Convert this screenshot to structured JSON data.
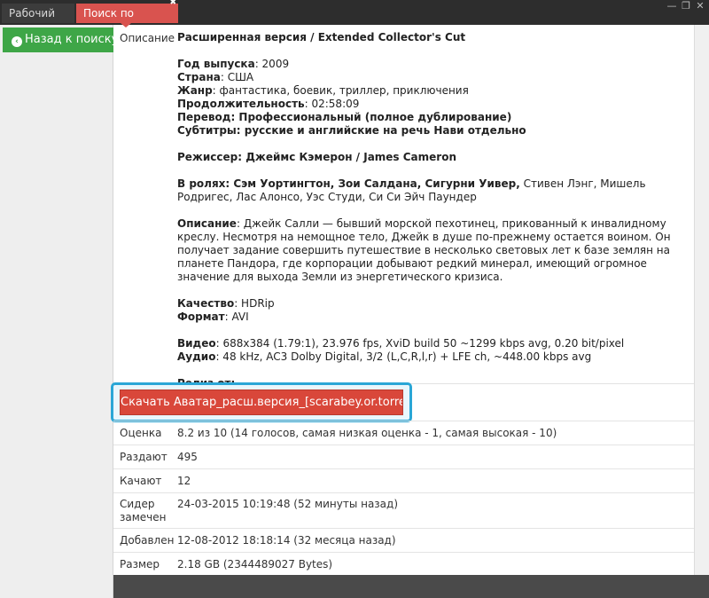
{
  "tabs": [
    {
      "label": "Рабочий стол"
    },
    {
      "label": "Поиск по торрентам"
    }
  ],
  "sidebar": {
    "back_label": "Назад к поиску"
  },
  "description": {
    "label": "Описание",
    "title": "Расширенная версия / Extended Collector's Cut",
    "year_key": "Год выпуска",
    "year_val": ": 2009",
    "country_key": "Страна",
    "country_val": ": США",
    "genre_key": "Жанр",
    "genre_val": ": фантастика, боевик, триллер, приключения",
    "duration_key": "Продолжительность",
    "duration_val": ": 02:58:09",
    "translation": "Перевод: Профессиональный (полное дублирование)",
    "subtitles": "Субтитры: русские и английские на речь Нави отдельно",
    "director": "Режиссер: Джеймс Кэмерон / James Cameron",
    "cast_bold": "В ролях: Сэм Уортингтон, Зои Салдана, Сигурни Уивер,",
    "cast_rest": " Стивен Лэнг, Мишель Родригес, Лас Алонсо, Уэс Студи, Си Си Эйч Паундер",
    "plot_key": "Описание",
    "plot_text": ": Джейк Салли — бывший морской пехотинец, прикованный к инвалидному креслу. Несмотря на немощное тело, Джейк в душе по-прежнему остается воином. Он получает задание совершить путешествие в несколько световых лет к базе землян на планете Пандора, где корпорации добывают редкий минерал, имеющий огромное значение для выхода Земли из энергетического кризиса.",
    "quality_key": "Качество",
    "quality_val": ": HDRip",
    "format_key": "Формат",
    "format_val": ": AVI",
    "video_key": "Видео",
    "video_val": ": 688x384 (1.79:1), 23.976 fps, XviD build 50 ~1299 kbps avg, 0.20 bit/pixel",
    "audio_key": "Аудио",
    "audio_val": ": 48 kHz, AC3 Dolby Digital, 3/2 (L,C,R,l,r) + LFE ch, ~448.00 kbps avg",
    "release": "Релиз от:"
  },
  "download": {
    "label": "Скачать Аватар_расш.версия_[scarabey.or.torrent"
  },
  "info": [
    {
      "key": "Оценка",
      "value": "8.2 из 10 (14 голосов, самая низкая оценка - 1, самая высокая - 10)"
    },
    {
      "key": "Раздают",
      "value": "495"
    },
    {
      "key": "Качают",
      "value": "12"
    },
    {
      "key": "Сидер замечен",
      "value": "24-03-2015 10:19:48 (52 минуты назад)"
    },
    {
      "key": "Добавлен",
      "value": "12-08-2012 18:18:14 (32 месяца назад)"
    },
    {
      "key": "Размер",
      "value": "2.18 GB (2344489027 Bytes)"
    }
  ],
  "colors": {
    "accent_red": "#d9473a",
    "accent_green": "#3ea647",
    "highlight_blue": "#2aa6d6"
  }
}
